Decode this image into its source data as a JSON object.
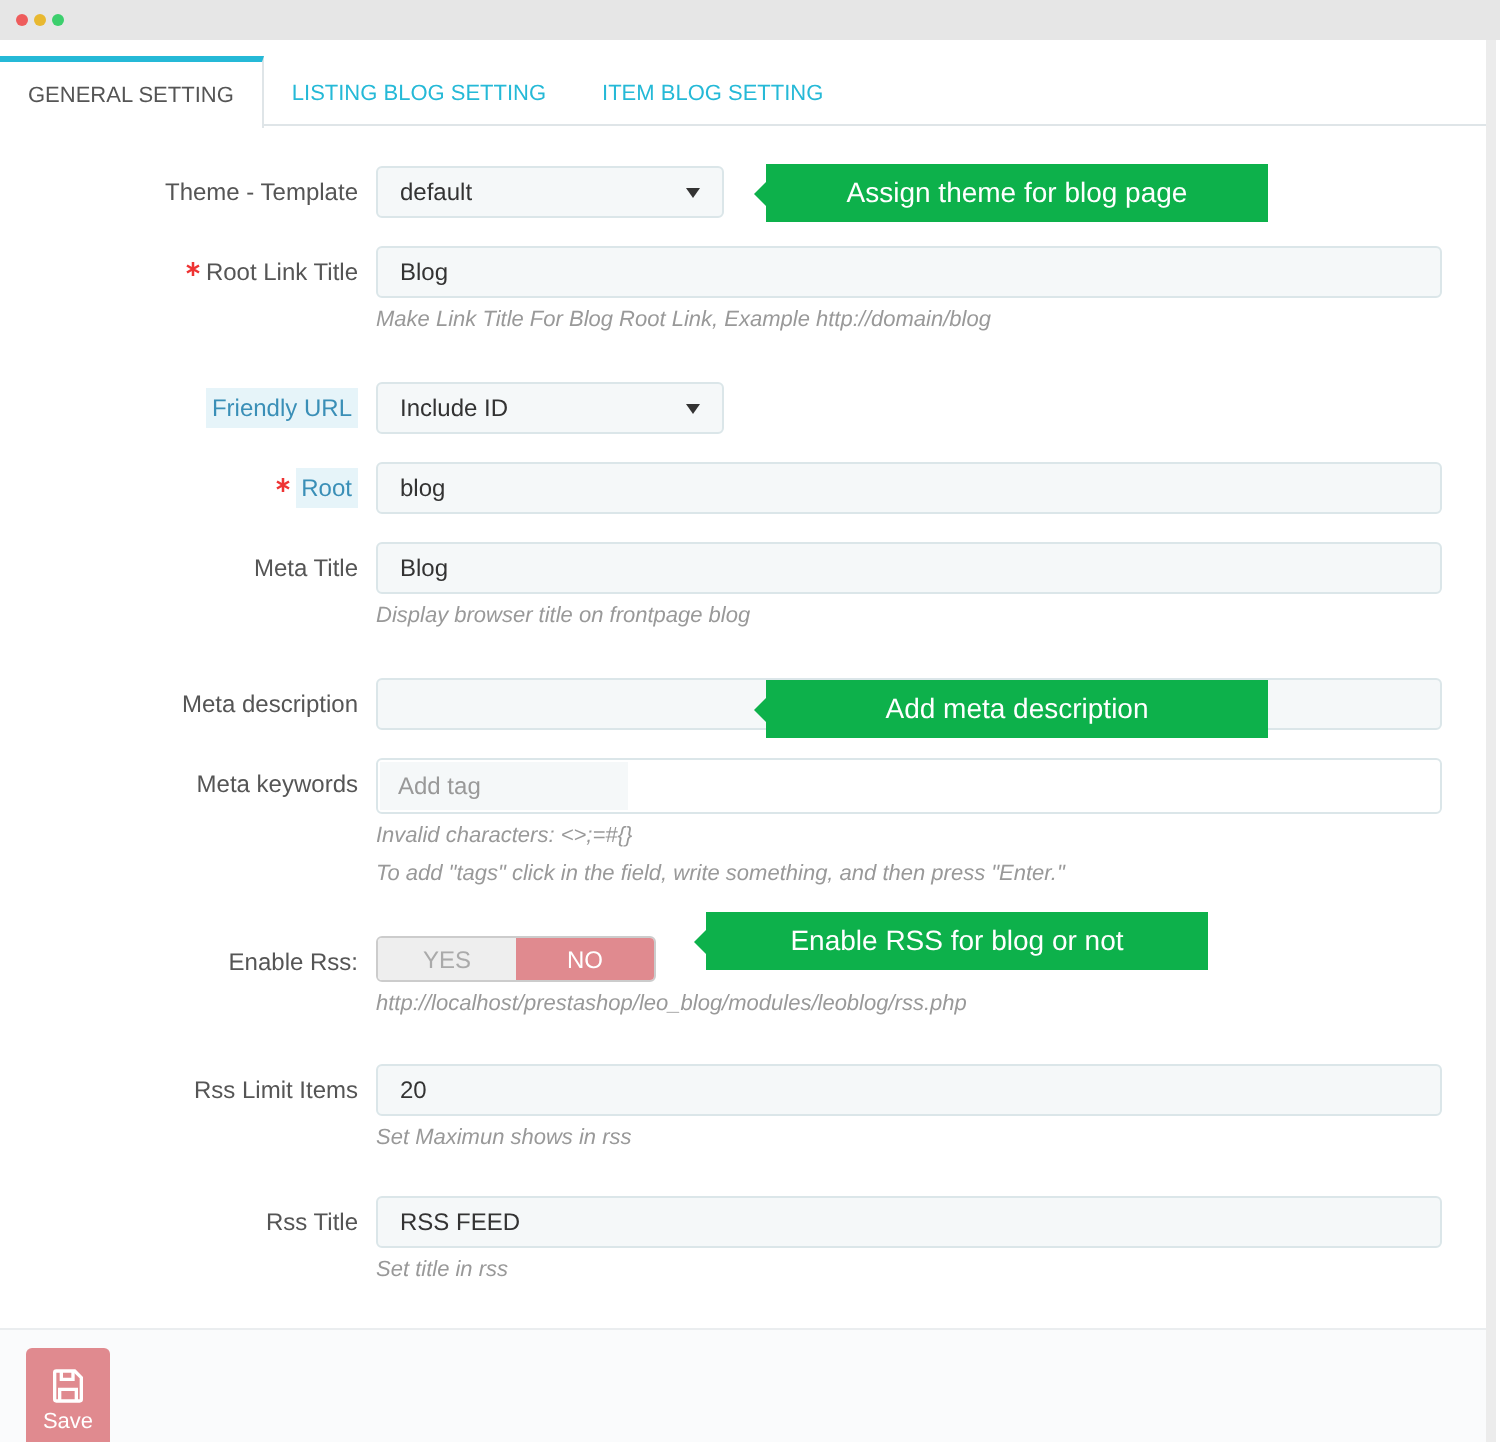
{
  "tabs": [
    {
      "label": "GENERAL SETTING",
      "selected": true
    },
    {
      "label": "LISTING BLOG SETTING",
      "selected": false
    },
    {
      "label": "ITEM BLOG SETTING",
      "selected": false
    }
  ],
  "fields": [
    {
      "kind": "select",
      "label": "Theme - Template",
      "required": false,
      "highlighted": false,
      "value": "default",
      "callout": "Assign theme for blog page"
    },
    {
      "kind": "text",
      "label": "Root Link Title",
      "required": true,
      "highlighted": false,
      "value": "Blog",
      "help": [
        "Make Link Title For Blog Root Link, Example http://domain/blog"
      ]
    },
    {
      "kind": "select",
      "label": "Friendly URL",
      "required": false,
      "highlighted": true,
      "value": "Include ID"
    },
    {
      "kind": "text",
      "label": "Root",
      "required": true,
      "highlighted": true,
      "value": "blog"
    },
    {
      "kind": "text",
      "label": "Meta Title",
      "required": false,
      "highlighted": false,
      "value": "Blog",
      "help": [
        "Display browser title on frontpage blog"
      ]
    },
    {
      "kind": "text",
      "label": "Meta description",
      "required": false,
      "highlighted": false,
      "callout": "Add meta description"
    },
    {
      "kind": "tags",
      "label": "Meta keywords",
      "required": false,
      "highlighted": false,
      "placeholder": "Add tag",
      "help": [
        "Invalid characters: <>;=#{}",
        "To add \"tags\" click in the field, write something, and then press \"Enter.\""
      ]
    },
    {
      "kind": "toggle",
      "label": "Enable Rss:",
      "required": false,
      "highlighted": false,
      "options": [
        {
          "label": "YES",
          "selected": false
        },
        {
          "label": "NO",
          "selected": true
        }
      ],
      "callout": "Enable RSS for blog or not",
      "help": [
        "http://localhost/prestashop/leo_blog/modules/leoblog/rss.php"
      ]
    },
    {
      "kind": "text",
      "label": "Rss Limit Items",
      "required": false,
      "highlighted": false,
      "value": "20",
      "help": [
        "Set Maximun shows in rss"
      ]
    },
    {
      "kind": "text",
      "label": "Rss Title",
      "required": false,
      "highlighted": false,
      "value": "RSS FEED",
      "help": [
        "Set title in rss"
      ]
    }
  ],
  "save_button": "Save"
}
